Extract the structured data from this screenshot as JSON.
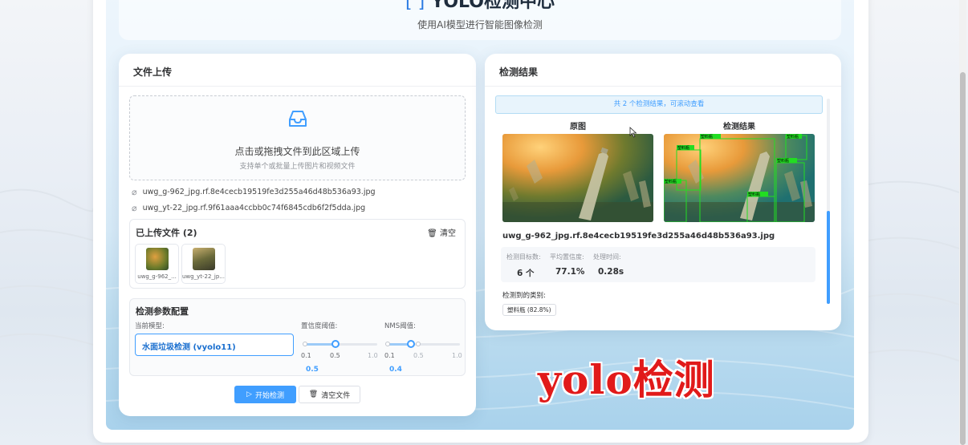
{
  "header": {
    "title": "YOLO检测中心",
    "subtitle": "使用AI模型进行智能图像检测"
  },
  "upload_panel": {
    "title": "文件上传",
    "drop_zone": {
      "text": "点击或拖拽文件到此区域上传",
      "tip": "支持单个或批量上传图片和视频文件"
    },
    "file_list": [
      "uwg_g-962_jpg.rf.8e4cecb19519fe3d255a46d48b536a93.jpg",
      "uwg_yt-22_jpg.rf.9f61aaa4ccbb0c74f6845cdb6f2f5dda.jpg"
    ],
    "uploaded": {
      "title": "已上传文件 (2)",
      "clear_label": "清空",
      "thumbs": [
        "uwg_g-962_...",
        "uwg_yt-22_jp..."
      ]
    },
    "params": {
      "title": "检测参数配置",
      "model_label": "当前模型:",
      "model_value": "水面垃圾检测 (vyolo11)",
      "conf_label": "置信度阈值:",
      "conf_ticks": [
        "0.1",
        "0.5",
        "1.0"
      ],
      "conf_value": "0.5",
      "nms_label": "NMS阈值:",
      "nms_ticks": [
        "0.1",
        "0.5",
        "1.0"
      ],
      "nms_value": "0.4"
    },
    "buttons": {
      "start": "开始检测",
      "clear_files": "清空文件"
    }
  },
  "result_panel": {
    "title": "检测结果",
    "summary": "共 2 个检测结果，可滚动查看",
    "original_label": "原图",
    "result_label": "检测结果",
    "file_name": "uwg_g-962_jpg.rf.8e4cecb19519fe3d255a46d48b536a93.jpg",
    "stats": {
      "count_label": "检测目标数:",
      "count_value": "6 个",
      "avg_conf_label": "平均置信度:",
      "avg_conf_value": "77.1%",
      "time_label": "处理时间:",
      "time_value": "0.28s"
    },
    "classes_label": "检测到的类别:",
    "class_tag": "塑料瓶 (82.8%)",
    "box_label": "塑料瓶"
  },
  "overlay_caption": "yolo检测",
  "colors": {
    "primary": "#409eff",
    "overlay_red": "#e11a1a",
    "box_green": "#22dd22"
  },
  "icons": {
    "upload": "inbox-icon",
    "attachment": "paperclip-icon",
    "delete": "trash-icon",
    "play": "play-circle-icon"
  }
}
